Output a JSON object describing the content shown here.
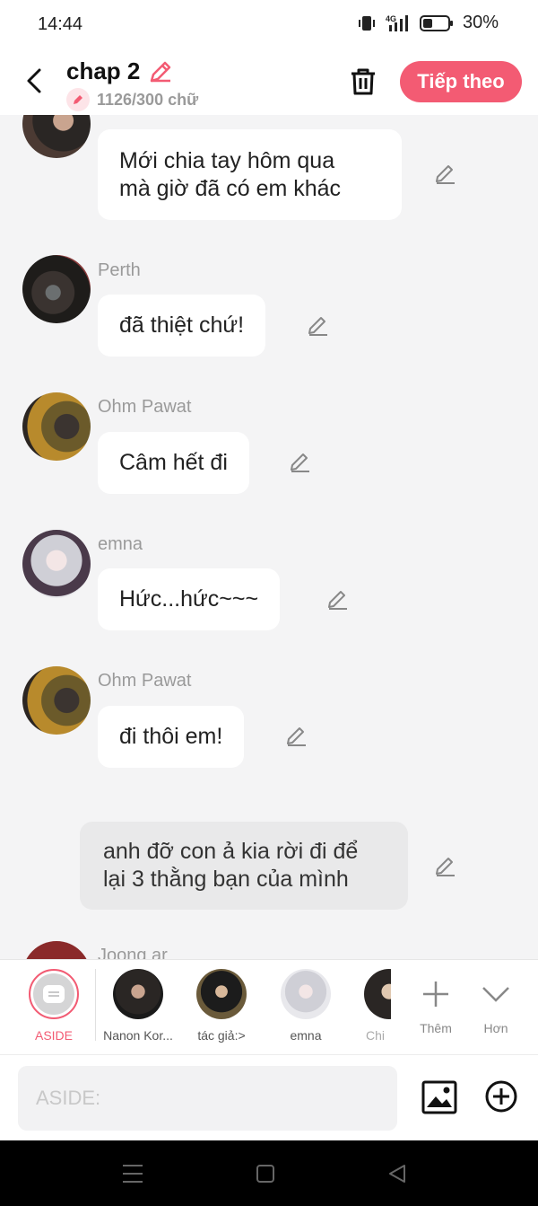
{
  "status_bar": {
    "time": "14:44",
    "battery": "30%"
  },
  "header": {
    "title": "chap 2",
    "word_count": "1126/300 chữ",
    "next_label": "Tiếp theo"
  },
  "messages": [
    {
      "type": "character",
      "name": "",
      "text_lines": [
        "Mới chia tay hôm qua",
        "mà giờ đã có em khác"
      ]
    },
    {
      "type": "character",
      "name": "Perth",
      "text_lines": [
        "đã thiệt chứ!"
      ]
    },
    {
      "type": "character",
      "name": "Ohm Pawat",
      "text_lines": [
        "Câm hết đi"
      ]
    },
    {
      "type": "character",
      "name": "emna",
      "text_lines": [
        "Hức...hức~~~"
      ]
    },
    {
      "type": "character",
      "name": "Ohm Pawat",
      "text_lines": [
        "đi thôi em!"
      ]
    },
    {
      "type": "aside",
      "text_lines": [
        "anh đỡ con ả kia rời đi để",
        "lại 3 thằng bạn của mình"
      ]
    },
    {
      "type": "character",
      "name": "Joong ar",
      "partial": true
    }
  ],
  "character_tray": [
    {
      "label": "ASIDE",
      "selected": true
    },
    {
      "label": "Nanon Kor..."
    },
    {
      "label": "tác giả:>"
    },
    {
      "label": "emna"
    },
    {
      "label": "Chi"
    },
    {
      "label": "Thêm"
    },
    {
      "label": "Hơn"
    }
  ],
  "input": {
    "placeholder": "ASIDE:"
  },
  "colors": {
    "accent": "#f35b73",
    "background": "#f4f4f5",
    "bubble": "#ffffff",
    "aside_bubble": "#e9e9ea"
  }
}
